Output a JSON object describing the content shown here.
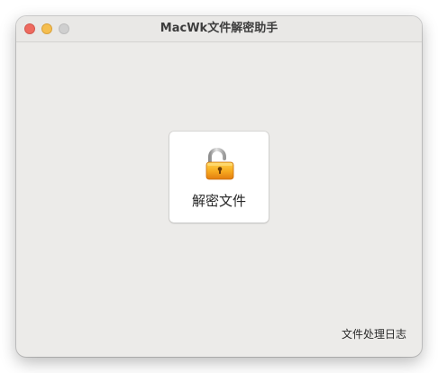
{
  "window": {
    "title": "MacWk文件解密助手"
  },
  "main": {
    "decrypt_button": {
      "label": "解密文件",
      "icon": "unlocked-padlock-icon"
    },
    "log_link": "文件处理日志"
  },
  "colors": {
    "window_bg": "#ecebe9",
    "close": "#ee6a5f",
    "minimize": "#f5be4f",
    "maximize_disabled": "#cfcfcf",
    "lock_body": "#f2a21e"
  }
}
